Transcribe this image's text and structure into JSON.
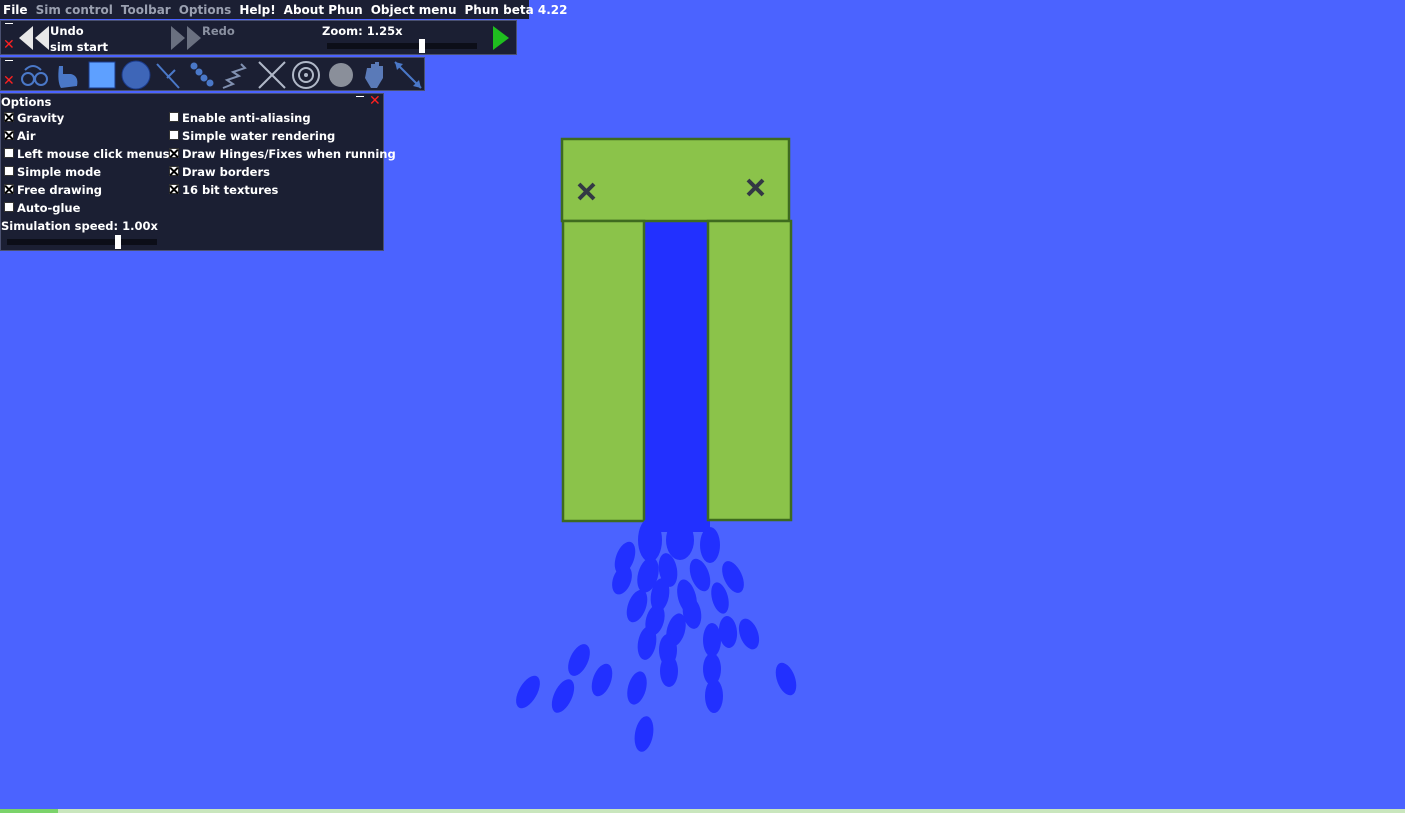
{
  "menu": {
    "file": "File",
    "sim_control": "Sim control",
    "toolbar": "Toolbar",
    "options": "Options",
    "help": "Help!",
    "about": "About Phun",
    "object_menu": "Object menu",
    "version": "Phun beta 4.22"
  },
  "sim_control": {
    "undo_label": "Undo",
    "undo_sub": "sim start",
    "redo_label": "Redo",
    "zoom_label": "Zoom: 1.25x",
    "zoom_value": 1.25
  },
  "toolbar": {
    "tools": [
      {
        "name": "chain-tool-icon"
      },
      {
        "name": "hand-tool-icon"
      },
      {
        "name": "box-tool-icon"
      },
      {
        "name": "circle-tool-icon"
      },
      {
        "name": "laser-tool-icon"
      },
      {
        "name": "chain-balls-icon"
      },
      {
        "name": "spring-tool-icon"
      },
      {
        "name": "fixate-tool-icon"
      },
      {
        "name": "hinge-tool-icon"
      },
      {
        "name": "texture-tool-icon"
      },
      {
        "name": "drag-hand-icon"
      },
      {
        "name": "scale-tool-icon"
      }
    ]
  },
  "options_panel": {
    "title": "Options",
    "left": [
      {
        "label": "Gravity",
        "checked": true
      },
      {
        "label": "Air",
        "checked": true
      },
      {
        "label": "Left mouse click menus",
        "checked": false
      },
      {
        "label": "Simple mode",
        "checked": false
      },
      {
        "label": "Free drawing",
        "checked": true
      },
      {
        "label": "Auto-glue",
        "checked": false
      }
    ],
    "right": [
      {
        "label": "Enable anti-aliasing",
        "checked": false
      },
      {
        "label": "Simple water rendering",
        "checked": false
      },
      {
        "label": "Draw Hinges/Fixes when running",
        "checked": true
      },
      {
        "label": "Draw borders",
        "checked": true
      },
      {
        "label": "16 bit textures",
        "checked": true
      }
    ],
    "speed_label": "Simulation speed: 1.00x",
    "speed_value": 1.0
  },
  "colors": {
    "background": "#4b63ff",
    "shape_fill": "#8bc34a",
    "shape_border": "#3e6b1f",
    "water": "#2230ff",
    "panel": "#1b1f33"
  }
}
